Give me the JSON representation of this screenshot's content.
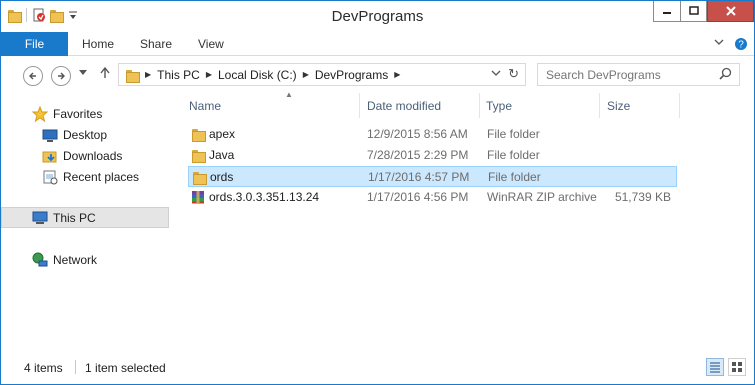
{
  "window": {
    "title": "DevPrograms"
  },
  "ribbon": {
    "tabs": [
      "File",
      "Home",
      "Share",
      "View"
    ]
  },
  "address": {
    "crumbs": [
      "This PC",
      "Local Disk (C:)",
      "DevPrograms"
    ]
  },
  "search": {
    "placeholder": "Search DevPrograms"
  },
  "navpane": {
    "favorites_label": "Favorites",
    "favorites": [
      "Desktop",
      "Downloads",
      "Recent places"
    ],
    "thispc_label": "This PC",
    "network_label": "Network"
  },
  "columns": {
    "name": "Name",
    "date": "Date modified",
    "type": "Type",
    "size": "Size"
  },
  "files": [
    {
      "name": "apex",
      "date": "12/9/2015 8:56 AM",
      "type": "File folder",
      "size": "",
      "icon": "folder-icon"
    },
    {
      "name": "Java",
      "date": "7/28/2015 2:29 PM",
      "type": "File folder",
      "size": "",
      "icon": "folder-icon"
    },
    {
      "name": "ords",
      "date": "1/17/2016 4:57 PM",
      "type": "File folder",
      "size": "",
      "icon": "folder-icon",
      "selected": true
    },
    {
      "name": "ords.3.0.3.351.13.24",
      "date": "1/17/2016 4:56 PM",
      "type": "WinRAR ZIP archive",
      "size": "51,739 KB",
      "icon": "winrar-archive-icon"
    }
  ],
  "status": {
    "items": "4 items",
    "selected": "1 item selected"
  },
  "colors": {
    "accent": "#1979ca",
    "selection": "#cce8ff",
    "selection_border": "#99d1ff",
    "close": "#c7504b"
  }
}
